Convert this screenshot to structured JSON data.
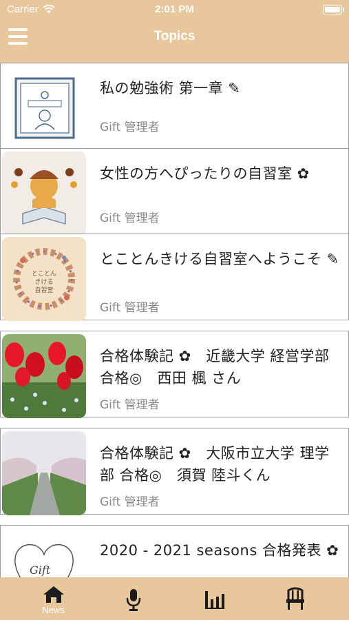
{
  "status_bar": {
    "carrier": "Carrier",
    "time": "2:01 PM"
  },
  "nav": {
    "title": "Topics",
    "menu_icon": "hamburger-menu-icon"
  },
  "topics": [
    {
      "title": "私の勉強術 第一章 ✎",
      "author": "Gift 管理者",
      "thumbnail": "logo-stamp-image"
    },
    {
      "title": "女性の方へぴったりの自習室 ✿",
      "author": "Gift 管理者",
      "thumbnail": "girl-reading-illustration"
    },
    {
      "title": "とことんきける自習室へようこそ ✎",
      "author": "Gift 管理者",
      "thumbnail": "wreath-illustration"
    },
    {
      "title": "合格体験記 ✿　近畿大学 経営学部 合格◎　西田 楓 さん",
      "author": "Gift 管理者",
      "thumbnail": "tulip-photo"
    },
    {
      "title": "合格体験記 ✿　大阪市立大学 理学部 合格◎　須賀 陸斗くん",
      "author": "Gift 管理者",
      "thumbnail": "cherry-blossom-canal-photo"
    },
    {
      "title": "2020 - 2021 seasons 合格発表 ✿",
      "author": "",
      "thumbnail": "gift-heart-logo"
    }
  ],
  "tabs": [
    {
      "label": "News",
      "icon": "house-icon",
      "active": true
    },
    {
      "label": "",
      "icon": "microphone-icon"
    },
    {
      "label": "",
      "icon": "bar-chart-icon"
    },
    {
      "label": "",
      "icon": "chair-icon"
    }
  ],
  "colors": {
    "theme": "#e9c79c",
    "cell_border": "#9a9a9a",
    "author_text": "#888888"
  }
}
